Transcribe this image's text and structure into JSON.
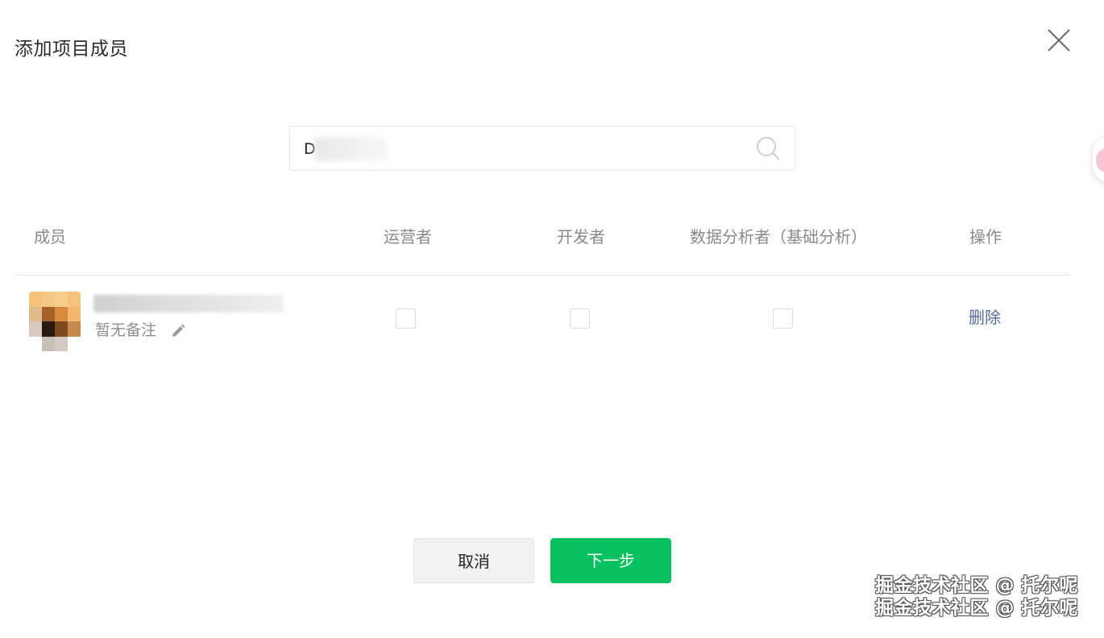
{
  "dialog": {
    "title": "添加项目成员",
    "close_icon": "close-icon"
  },
  "search": {
    "value": "D",
    "icon": "search-icon"
  },
  "table": {
    "columns": [
      "成员",
      "运营者",
      "开发者",
      "数据分析者（基础分析）",
      "操作"
    ],
    "rows": [
      {
        "remark": "暂无备注",
        "edit_icon": "pencil-icon",
        "operator_checked": false,
        "developer_checked": false,
        "analyst_checked": false,
        "action": "删除"
      }
    ]
  },
  "footer": {
    "cancel_label": "取消",
    "next_label": "下一步"
  },
  "watermark": {
    "line1": "掘金技术社区 @ 托尔呢",
    "line2": "掘金技术社区 @ 托尔呢"
  },
  "colors": {
    "primary_green": "#07c160",
    "link_blue": "#576b95"
  }
}
